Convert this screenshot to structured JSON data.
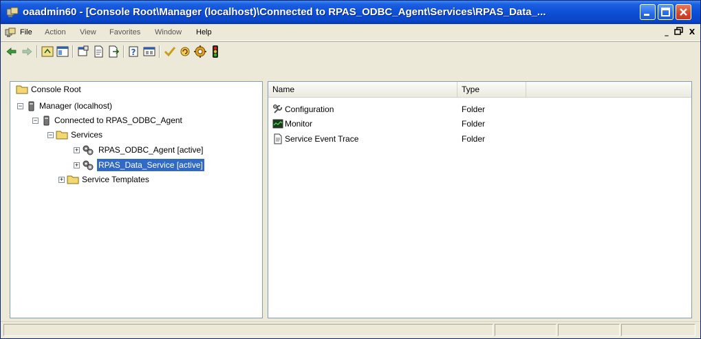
{
  "window": {
    "title": "oaadmin60 - [Console Root\\Manager (localhost)\\Connected to RPAS_ODBC_Agent\\Services\\RPAS_Data_..."
  },
  "menu": {
    "file": "File",
    "action": "Action",
    "view": "View",
    "favorites": "Favorites",
    "window": "Window",
    "help": "Help",
    "mdi_minimize": "_",
    "mdi_close": "X"
  },
  "tree": {
    "console_root": "Console Root",
    "manager": "Manager (localhost)",
    "connected": "Connected to RPAS_ODBC_Agent",
    "services": "Services",
    "odbc_agent": "RPAS_ODBC_Agent [active]",
    "data_service": "RPAS_Data_Service [active]",
    "service_templates": "Service Templates"
  },
  "list": {
    "columns": [
      "Name",
      "Type"
    ],
    "rows": [
      {
        "name": "Configuration",
        "type": "Folder",
        "icon": "wrench-icon"
      },
      {
        "name": "Monitor",
        "type": "Folder",
        "icon": "monitor-icon"
      },
      {
        "name": "Service Event Trace",
        "type": "Folder",
        "icon": "document-icon"
      }
    ]
  },
  "colors": {
    "titlebar": "#0d4fd6",
    "selection": "#316ac5",
    "chrome": "#ece9d8"
  }
}
